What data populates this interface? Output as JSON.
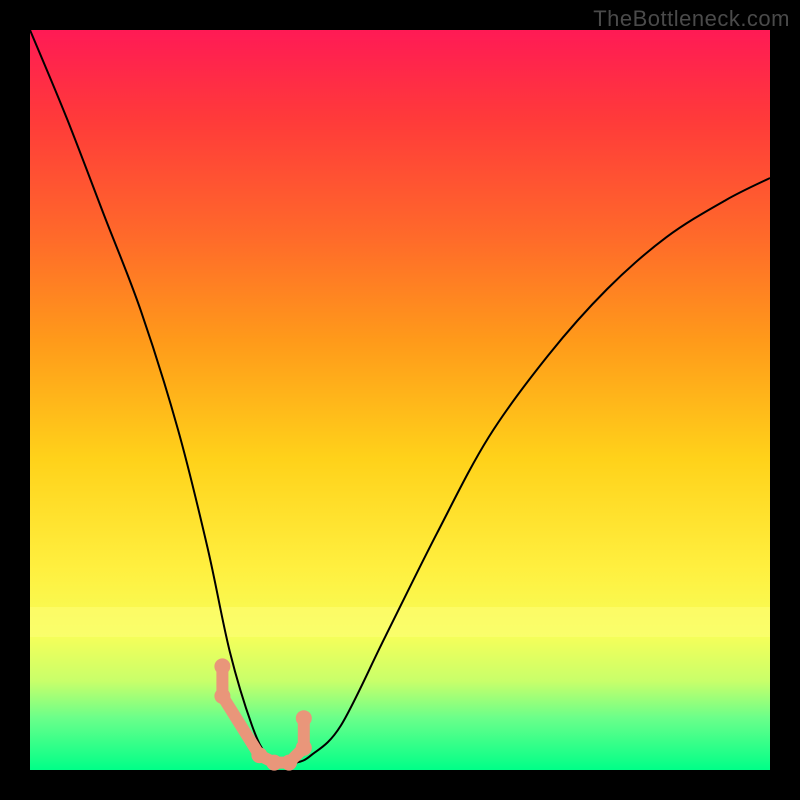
{
  "attribution": "TheBottleneck.com",
  "colors": {
    "background": "#000000",
    "gradient_top": "#ff1a55",
    "gradient_bottom": "#00ff88",
    "curve": "#000000",
    "highlight_dots": "#e9967a"
  },
  "chart_data": {
    "type": "line",
    "title": "",
    "xlabel": "",
    "ylabel": "",
    "xlim": [
      0,
      100
    ],
    "ylim": [
      0,
      100
    ],
    "grid": false,
    "legend": false,
    "annotations": [
      "TheBottleneck.com"
    ],
    "series": [
      {
        "name": "bottleneck-curve",
        "x": [
          0,
          5,
          10,
          15,
          20,
          24,
          27,
          30,
          32,
          34,
          36,
          38,
          42,
          48,
          55,
          62,
          70,
          78,
          86,
          94,
          100
        ],
        "values": [
          100,
          88,
          75,
          62,
          46,
          30,
          16,
          6,
          2,
          1,
          1,
          2,
          6,
          18,
          32,
          45,
          56,
          65,
          72,
          77,
          80
        ]
      }
    ],
    "highlight_points": {
      "name": "salmon-dots",
      "x": [
        26,
        26,
        31,
        33,
        35,
        37,
        37
      ],
      "values": [
        14,
        10,
        2,
        1,
        1,
        3,
        7
      ]
    }
  }
}
